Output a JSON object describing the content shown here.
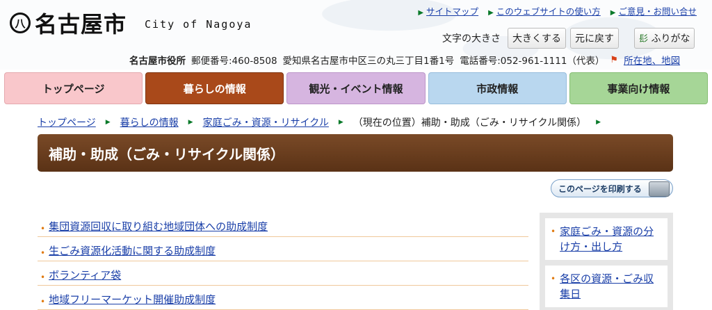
{
  "header": {
    "logo_mark": "八",
    "logo_name": "名古屋市",
    "logo_sub": "City of Nagoya",
    "top_links": [
      "サイトマップ",
      "このウェブサイトの使い方",
      "ご意見・お問い合せ"
    ],
    "text_size_label": "文字の大きさ",
    "enlarge_label": "大きくする",
    "reset_label": "元に戻す",
    "furigana_label": "ふりがな",
    "office_name": "名古屋市役所",
    "postal": "郵便番号:460-8508",
    "address": "愛知県名古屋市中区三の丸三丁目1番1号",
    "phone": "電話番号:052-961-1111（代表）",
    "map_link": "所在地、地図"
  },
  "nav": {
    "tabs": [
      "トップページ",
      "暮らしの情報",
      "観光・イベント情報",
      "市政情報",
      "事業向け情報"
    ]
  },
  "breadcrumb": {
    "items": [
      "トップページ",
      "暮らしの情報",
      "家庭ごみ・資源・リサイクル"
    ],
    "current": "（現在の位置）補助・助成（ごみ・リサイクル関係）"
  },
  "main": {
    "title": "補助・助成（ごみ・リサイクル関係）",
    "print_label": "このページを印刷する",
    "links": [
      "集団資源回収に取り組む地域団体への助成制度",
      "生ごみ資源化活動に関する助成制度",
      "ボランティア袋",
      "地域フリーマーケット開催助成制度"
    ]
  },
  "side": {
    "links": [
      "家庭ごみ・資源の分け方・出し方",
      "各区の資源・ごみ収集日"
    ]
  }
}
